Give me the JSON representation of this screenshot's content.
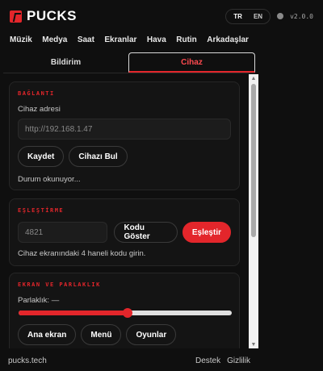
{
  "header": {
    "brand": "PUCKS",
    "languages": [
      "TR",
      "EN"
    ],
    "version": "v2.0.0"
  },
  "nav": {
    "items": [
      "Müzik",
      "Medya",
      "Saat",
      "Ekranlar",
      "Hava",
      "Rutin",
      "Arkadaşlar"
    ]
  },
  "tabs": [
    {
      "label": "Bildirim",
      "active": false
    },
    {
      "label": "Cihaz",
      "active": true
    }
  ],
  "connection": {
    "title": "BAĞLANTI",
    "address_label": "Cihaz adresi",
    "address_placeholder": "http://192.168.1.47",
    "save_label": "Kaydet",
    "find_label": "Cihazı Bul",
    "status": "Durum okunuyor..."
  },
  "pairing": {
    "title": "EŞLEŞTİRME",
    "code_placeholder": "4821",
    "show_code_label": "Kodu Göster",
    "pair_label": "Eşleştir",
    "hint": "Cihaz ekranındaki 4 haneli kodu girin."
  },
  "display": {
    "title": "EKRAN VE PARLAKLIK",
    "brightness_label": "Parlaklık: —",
    "brightness_fraction": 0.51,
    "buttons": [
      "Ana ekran",
      "Menü",
      "Oyunlar"
    ]
  },
  "footer": {
    "site": "pucks.tech",
    "support": "Destek",
    "privacy": "Gizlilik"
  },
  "colors": {
    "accent": "#e3262b",
    "background": "#0f0f0f",
    "card": "#141414"
  }
}
